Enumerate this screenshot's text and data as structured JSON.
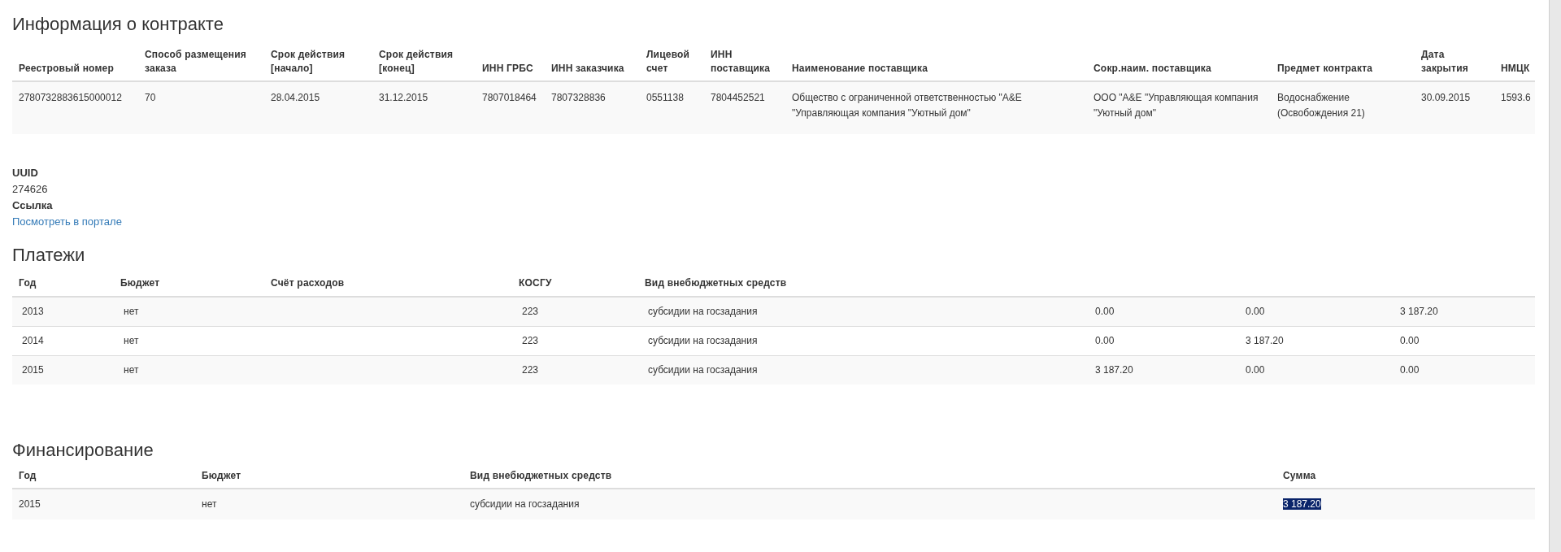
{
  "contract": {
    "title": "Информация о контракте",
    "columns": [
      "Реестровый номер",
      "Способ размещения заказа",
      "Срок действия [начало]",
      "Срок действия [конец]",
      "ИНН ГРБС",
      "ИНН заказчика",
      "Лицевой счет",
      "ИНН поставщика",
      "Наименование поставщика",
      "Сокр.наим. поставщика",
      "Предмет контракта",
      "Дата закрытия",
      "НМЦК"
    ],
    "rows": [
      [
        "2780732883615000012",
        "70",
        "28.04.2015",
        "31.12.2015",
        "7807018464",
        "7807328836",
        "0551138",
        "7804452521",
        "Общество с ограниченной ответственностью \"А&E \"Управляющая компания \"Уютный дом\"",
        "ООО \"А&E \"Управляющая компания \"Уютный дом\"",
        "Водоснабжение (Освобождения 21)",
        "30.09.2015",
        "1593.6"
      ]
    ]
  },
  "details": [
    {
      "label": "UUID",
      "value": "274626",
      "kind": "text"
    },
    {
      "label": "Ссылка",
      "value": "Посмотреть в портале",
      "kind": "link"
    }
  ],
  "payments": {
    "title": "Платежи",
    "columns": [
      "Год",
      "Бюджет",
      "Счёт расходов",
      "КОСГУ",
      "Вид внебюджетных средств"
    ],
    "rows": [
      [
        "2013",
        "нет",
        "",
        "223",
        "субсидии на госзадания",
        "0.00",
        "0.00",
        "3 187.20"
      ],
      [
        "2014",
        "нет",
        "",
        "223",
        "субсидии на госзадания",
        "0.00",
        "3 187.20",
        "0.00"
      ],
      [
        "2015",
        "нет",
        "",
        "223",
        "субсидии на госзадания",
        "3 187.20",
        "0.00",
        "0.00"
      ]
    ]
  },
  "financing": {
    "title": "Финансирование",
    "columns": [
      "Год",
      "Бюджет",
      "Вид внебюджетных средств",
      "Сумма"
    ],
    "rows": [
      {
        "cells": [
          {
            "text": "2015",
            "highlighted": false
          },
          {
            "text": "нет",
            "highlighted": false
          },
          {
            "text": "субсидии на госзадания",
            "highlighted": false
          },
          {
            "text": "3 187.20",
            "highlighted": true
          }
        ]
      }
    ]
  }
}
